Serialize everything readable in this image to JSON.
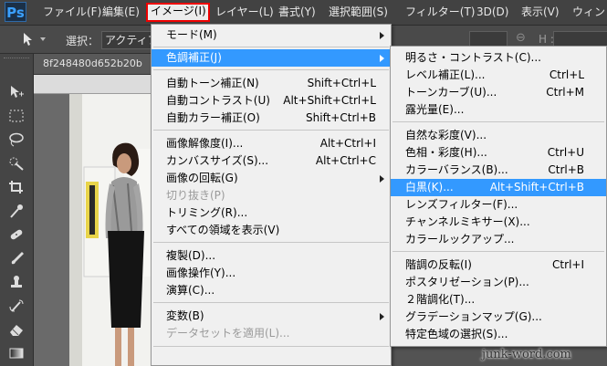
{
  "app": {
    "logo": "Ps"
  },
  "menubar": {
    "items": [
      {
        "label": "ファイル(F)",
        "active": false
      },
      {
        "label": "編集(E)",
        "active": false
      },
      {
        "label": "イメージ(I)",
        "active": true
      },
      {
        "label": "レイヤー(L)",
        "active": false
      },
      {
        "label": "書式(Y)",
        "active": false
      },
      {
        "label": "選択範囲(S)",
        "active": false
      },
      {
        "label": "フィルター(T)",
        "active": false
      },
      {
        "label": "3D(D)",
        "active": false
      },
      {
        "label": "表示(V)",
        "active": false
      },
      {
        "label": "ウィンドウ",
        "active": false
      }
    ]
  },
  "options_bar": {
    "select_label": "選択：",
    "select_value": "アクティブ",
    "h_label": "H :"
  },
  "document": {
    "tab_title": "8f248480d652b20b"
  },
  "image_menu": {
    "items": [
      {
        "label": "モード(M)",
        "shortcut": "",
        "submenu": true
      },
      {
        "label": "色調補正(J)",
        "shortcut": "",
        "submenu": true,
        "highlighted": true
      },
      {
        "label": "自動トーン補正(N)",
        "shortcut": "Shift+Ctrl+L"
      },
      {
        "label": "自動コントラスト(U)",
        "shortcut": "Alt+Shift+Ctrl+L"
      },
      {
        "label": "自動カラー補正(O)",
        "shortcut": "Shift+Ctrl+B"
      },
      {
        "label": "画像解像度(I)...",
        "shortcut": "Alt+Ctrl+I"
      },
      {
        "label": "カンバスサイズ(S)...",
        "shortcut": "Alt+Ctrl+C"
      },
      {
        "label": "画像の回転(G)",
        "shortcut": "",
        "submenu": true
      },
      {
        "label": "切り抜き(P)",
        "shortcut": "",
        "disabled": true
      },
      {
        "label": "トリミング(R)...",
        "shortcut": ""
      },
      {
        "label": "すべての領域を表示(V)",
        "shortcut": ""
      },
      {
        "label": "複製(D)...",
        "shortcut": ""
      },
      {
        "label": "画像操作(Y)...",
        "shortcut": ""
      },
      {
        "label": "演算(C)...",
        "shortcut": ""
      },
      {
        "label": "変数(B)",
        "shortcut": "",
        "submenu": true
      },
      {
        "label": "データセットを適用(L)...",
        "shortcut": "",
        "disabled": true
      }
    ]
  },
  "adjust_menu": {
    "items": [
      {
        "label": "明るさ・コントラスト(C)...",
        "shortcut": ""
      },
      {
        "label": "レベル補正(L)...",
        "shortcut": "Ctrl+L"
      },
      {
        "label": "トーンカーブ(U)...",
        "shortcut": "Ctrl+M"
      },
      {
        "label": "露光量(E)...",
        "shortcut": ""
      },
      {
        "label": "自然な彩度(V)...",
        "shortcut": ""
      },
      {
        "label": "色相・彩度(H)...",
        "shortcut": "Ctrl+U"
      },
      {
        "label": "カラーバランス(B)...",
        "shortcut": "Ctrl+B"
      },
      {
        "label": "白黒(K)...",
        "shortcut": "Alt+Shift+Ctrl+B",
        "highlighted": true
      },
      {
        "label": "レンズフィルター(F)...",
        "shortcut": ""
      },
      {
        "label": "チャンネルミキサー(X)...",
        "shortcut": ""
      },
      {
        "label": "カラールックアップ...",
        "shortcut": ""
      },
      {
        "label": "階調の反転(I)",
        "shortcut": "Ctrl+I"
      },
      {
        "label": "ポスタリゼーション(P)...",
        "shortcut": ""
      },
      {
        "label": "２階調化(T)...",
        "shortcut": ""
      },
      {
        "label": "グラデーションマップ(G)...",
        "shortcut": ""
      },
      {
        "label": "特定色域の選択(S)...",
        "shortcut": ""
      }
    ]
  },
  "watermark": "junk-word.com",
  "colors": {
    "highlight": "#3399ff",
    "active_border": "#e00000",
    "menubar_bg": "#424242"
  }
}
